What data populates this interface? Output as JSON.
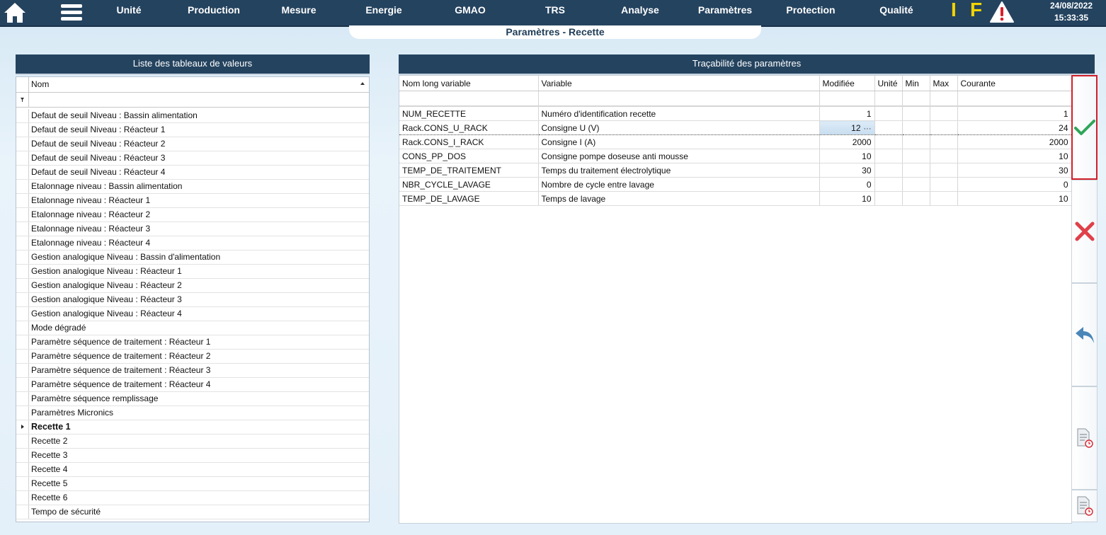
{
  "nav": {
    "items": [
      "Unité",
      "Production",
      "Mesure",
      "Energie",
      "GMAO",
      "TRS",
      "Analyse",
      "Paramètres",
      "Protection",
      "Qualité"
    ],
    "flag_i": "I",
    "flag_f": "F",
    "date": "24/08/2022",
    "time": "15:33:35"
  },
  "page": {
    "title": "Paramètres - Recette"
  },
  "left_panel": {
    "title": "Liste des tableaux de valeurs",
    "column": "Nom",
    "current_row": "Recette 1",
    "items": [
      "Defaut de seuil Niveau : Bassin alimentation",
      "Defaut de seuil Niveau : Réacteur 1",
      "Defaut de seuil Niveau : Réacteur 2",
      "Defaut de seuil Niveau : Réacteur 3",
      "Defaut de seuil Niveau : Réacteur 4",
      "Etalonnage niveau : Bassin alimentation",
      "Etalonnage niveau : Réacteur 1",
      "Etalonnage niveau : Réacteur 2",
      "Etalonnage niveau : Réacteur 3",
      "Etalonnage niveau : Réacteur 4",
      "Gestion analogique Niveau : Bassin d'alimentation",
      "Gestion analogique Niveau : Réacteur 1",
      "Gestion analogique Niveau : Réacteur 2",
      "Gestion analogique Niveau : Réacteur 3",
      "Gestion analogique Niveau : Réacteur 4",
      "Mode dégradé",
      "Paramètre séquence de traitement : Réacteur 1",
      "Paramètre séquence de traitement : Réacteur 2",
      "Paramètre séquence de traitement : Réacteur 3",
      "Paramètre séquence de traitement : Réacteur 4",
      "Paramètre séquence remplissage",
      "Paramètres Micronics",
      "Recette 1",
      "Recette 2",
      "Recette 3",
      "Recette 4",
      "Recette 5",
      "Recette 6",
      "Tempo de sécurité"
    ]
  },
  "right_panel": {
    "title": "Traçabilité des paramètres",
    "columns": [
      "Nom long variable",
      "Variable",
      "Modifiée",
      "Unité",
      "Min",
      "Max",
      "Courante"
    ],
    "rows": [
      {
        "name": "NUM_RECETTE",
        "variable": "Numéro d'identification recette",
        "modifiee": "1",
        "unite": "",
        "min": "",
        "max": "",
        "courante": "1"
      },
      {
        "name": "Rack.CONS_U_RACK",
        "variable": "Consigne U (V)",
        "modifiee": "12",
        "unite": "",
        "min": "",
        "max": "",
        "courante": "24"
      },
      {
        "name": "Rack.CONS_I_RACK",
        "variable": "Consigne I (A)",
        "modifiee": "2000",
        "unite": "",
        "min": "",
        "max": "",
        "courante": "2000"
      },
      {
        "name": "CONS_PP_DOS",
        "variable": "Consigne pompe doseuse anti mousse",
        "modifiee": "10",
        "unite": "",
        "min": "",
        "max": "",
        "courante": "10"
      },
      {
        "name": "TEMP_DE_TRAITEMENT",
        "variable": "Temps du traitement électrolytique",
        "modifiee": "30",
        "unite": "",
        "min": "",
        "max": "",
        "courante": "30"
      },
      {
        "name": "NBR_CYCLE_LAVAGE",
        "variable": "Nombre de cycle entre lavage",
        "modifiee": "0",
        "unite": "",
        "min": "",
        "max": "",
        "courante": "0"
      },
      {
        "name": "TEMP_DE_LAVAGE",
        "variable": "Temps de lavage",
        "modifiee": "10",
        "unite": "",
        "min": "",
        "max": "",
        "courante": "10"
      }
    ],
    "editing_ellipsis": "···"
  },
  "colors": {
    "header_bg": "#24435f",
    "flag_yellow": "#f2d400",
    "validate_green": "#2fa65a",
    "cancel_red": "#e0404a",
    "undo_blue": "#4a86b8",
    "validate_border": "#d21e2a"
  },
  "icons": {
    "home": "home-icon",
    "menu": "hamburger-menu-icon",
    "alert": "warning-triangle-icon",
    "validate": "checkmark-icon",
    "cancel": "cross-icon",
    "undo": "undo-arrow-icon",
    "doc_clock": "document-clock-icon"
  }
}
